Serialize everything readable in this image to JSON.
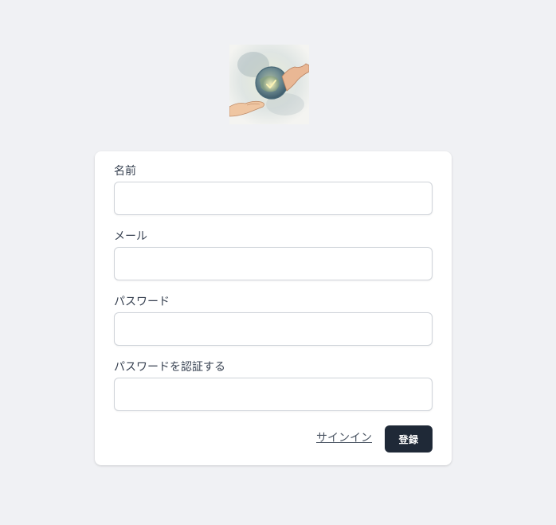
{
  "logo": {
    "icon": "hand-holding-globe-check-icon"
  },
  "form": {
    "fields": [
      {
        "label": "名前",
        "value": "",
        "type": "text"
      },
      {
        "label": "メール",
        "value": "",
        "type": "email"
      },
      {
        "label": "パスワード",
        "value": "",
        "type": "password"
      },
      {
        "label": "パスワードを認証する",
        "value": "",
        "type": "password"
      }
    ],
    "signin_link": "サインイン",
    "register_button": "登録"
  },
  "colors": {
    "background": "#f0f1f4",
    "card": "#ffffff",
    "button": "#1f2937",
    "label": "#374151",
    "input_border": "#cfd3d9"
  }
}
